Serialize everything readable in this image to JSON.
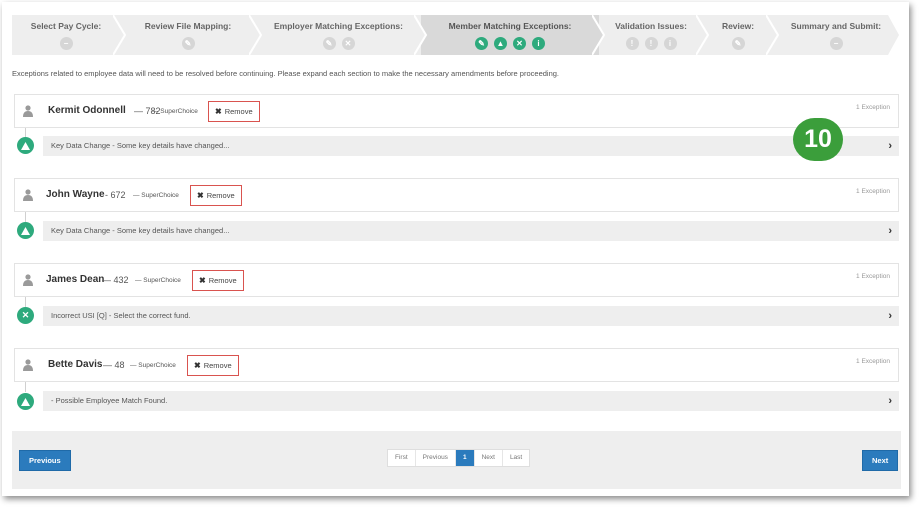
{
  "stepper": {
    "steps": [
      {
        "label": "Select Pay Cycle:"
      },
      {
        "label": "Review File Mapping:"
      },
      {
        "label": "Employer Matching Exceptions:"
      },
      {
        "label": "Member Matching Exceptions:"
      },
      {
        "label": "Validation Issues:"
      },
      {
        "label": "Review:"
      },
      {
        "label": "Summary and Submit:"
      }
    ],
    "active_index": 3
  },
  "intro_text": "Exceptions related to employee data will need to be resolved before continuing. Please expand each section to make the necessary amendments before proceeding.",
  "exceptions": [
    {
      "name": "Kermit Odonnell",
      "number": "— 782",
      "fund": "— SuperChoice",
      "remove_label": "Remove",
      "count": "1 Exception",
      "status_icon": "warning-triangle-icon",
      "issue": "Key Data Change - Some key details have changed..."
    },
    {
      "name": "John Wayne",
      "number": "- 672",
      "fund": "— SuperChoice",
      "remove_label": "Remove",
      "count": "1 Exception",
      "status_icon": "warning-triangle-icon",
      "issue": "Key Data Change - Some key details have changed..."
    },
    {
      "name": "James Dean",
      "number": "— 432",
      "fund": "— SuperChoice",
      "remove_label": "Remove",
      "count": "1 Exception",
      "status_icon": "error-x-icon",
      "issue": "Incorrect USI [Q] - Select the correct fund."
    },
    {
      "name": "Bette Davis",
      "number": "— 48",
      "fund": "— SuperChoice",
      "remove_label": "Remove",
      "count": "1 Exception",
      "status_icon": "warning-triangle-icon",
      "issue": "- Possible Employee Match Found."
    }
  ],
  "annotation_badge": "10",
  "footer": {
    "previous_label": "Previous",
    "next_label": "Next",
    "pagination": [
      "First",
      "Previous",
      "1",
      "Next",
      "Last"
    ],
    "current_page": "1"
  },
  "colors": {
    "accent_green": "#2eaa7d",
    "primary_blue": "#2b7bbd",
    "remove_red": "#d9534f",
    "badge_green": "#3b9e3b"
  }
}
